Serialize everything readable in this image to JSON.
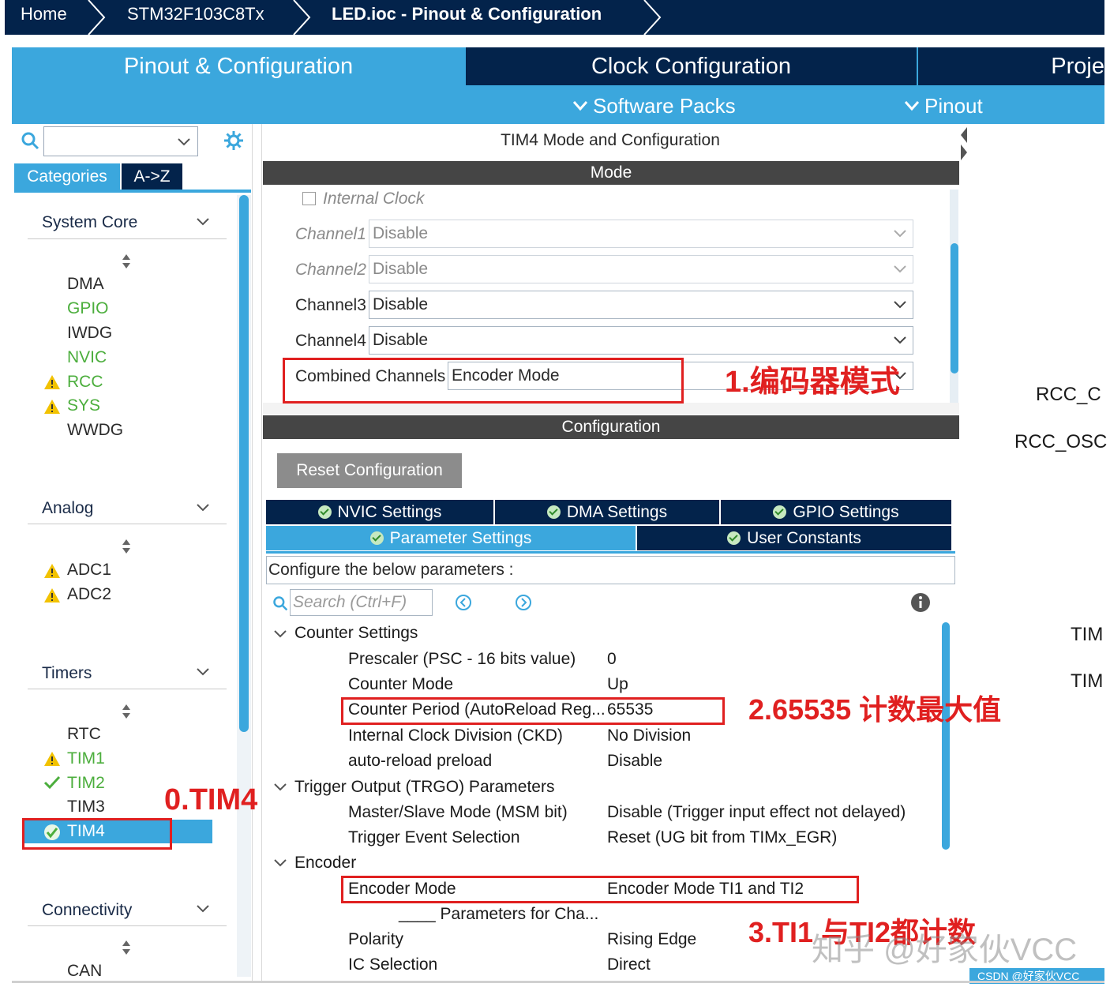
{
  "breadcrumb": {
    "home": "Home",
    "device": "STM32F103C8Tx",
    "current": "LED.ioc - Pinout & Configuration"
  },
  "main_tabs": {
    "pinout": "Pinout & Configuration",
    "clock": "Clock Configuration",
    "project": "Proje"
  },
  "submenu": {
    "software_packs": "Software Packs",
    "pinout": "Pinout"
  },
  "left": {
    "tab_categories": "Categories",
    "tab_az": "A->Z",
    "groups": {
      "system_core": {
        "title": "System Core",
        "items": [
          "DMA",
          "GPIO",
          "IWDG",
          "NVIC",
          "RCC",
          "SYS",
          "WWDG"
        ]
      },
      "analog": {
        "title": "Analog",
        "items": [
          "ADC1",
          "ADC2"
        ]
      },
      "timers": {
        "title": "Timers",
        "items": [
          "RTC",
          "TIM1",
          "TIM2",
          "TIM3",
          "TIM4"
        ]
      },
      "connectivity": {
        "title": "Connectivity",
        "items": [
          "CAN"
        ]
      }
    }
  },
  "mode": {
    "panel_title": "TIM4 Mode and Configuration",
    "section_title": "Mode",
    "internal_clock": "Internal Clock",
    "rows": [
      {
        "label": "Channel1",
        "value": "Disable"
      },
      {
        "label": "Channel2",
        "value": "Disable"
      },
      {
        "label": "Channel3",
        "value": "Disable"
      },
      {
        "label": "Channel4",
        "value": "Disable"
      },
      {
        "label": "Combined Channels",
        "value": "Encoder Mode"
      }
    ]
  },
  "config": {
    "section_title": "Configuration",
    "reset_button": "Reset Configuration",
    "tabs": {
      "nvic": "NVIC Settings",
      "dma": "DMA Settings",
      "gpio": "GPIO Settings",
      "parameter": "Parameter Settings",
      "user_constants": "User Constants"
    },
    "header": "Configure the below parameters :",
    "search_placeholder": "Search (Ctrl+F)",
    "sections": {
      "counter": {
        "title": "Counter Settings",
        "params": [
          {
            "name": "Prescaler (PSC - 16 bits value)",
            "value": "0"
          },
          {
            "name": "Counter Mode",
            "value": "Up"
          },
          {
            "name": "Counter Period (AutoReload Reg...",
            "value": "65535"
          },
          {
            "name": "Internal Clock Division (CKD)",
            "value": "No Division"
          },
          {
            "name": "auto-reload preload",
            "value": "Disable"
          }
        ]
      },
      "trgo": {
        "title": "Trigger Output (TRGO) Parameters",
        "params": [
          {
            "name": "Master/Slave Mode (MSM bit)",
            "value": "Disable (Trigger input effect not delayed)"
          },
          {
            "name": "Trigger Event Selection",
            "value": "Reset (UG bit from TIMx_EGR)"
          }
        ]
      },
      "encoder": {
        "title": "Encoder",
        "params": [
          {
            "name": "Encoder Mode",
            "value": "Encoder Mode TI1 and TI2"
          }
        ],
        "subheader": "____ Parameters for Cha...",
        "params2": [
          {
            "name": "Polarity",
            "value": "Rising Edge"
          },
          {
            "name": "IC Selection",
            "value": "Direct"
          }
        ]
      }
    }
  },
  "right": {
    "labels": [
      "RCC_C",
      "RCC_OSC",
      "TIM",
      "TIM"
    ]
  },
  "annotations": {
    "a0": "0.TIM4",
    "a1": "1.编码器模式",
    "a2": "2.65535 计数最大值",
    "a3": "3.TI1 与TI2都计数"
  },
  "watermark": "知乎 @好家伙VCC",
  "csdn": "CSDN @好家伙VCC",
  "colors": {
    "navy": "#03234b",
    "accent_blue": "#3ba7dd",
    "ok_green": "#4cae3d",
    "warn_yellow": "#f2c200",
    "annotation_red": "#e02020"
  }
}
